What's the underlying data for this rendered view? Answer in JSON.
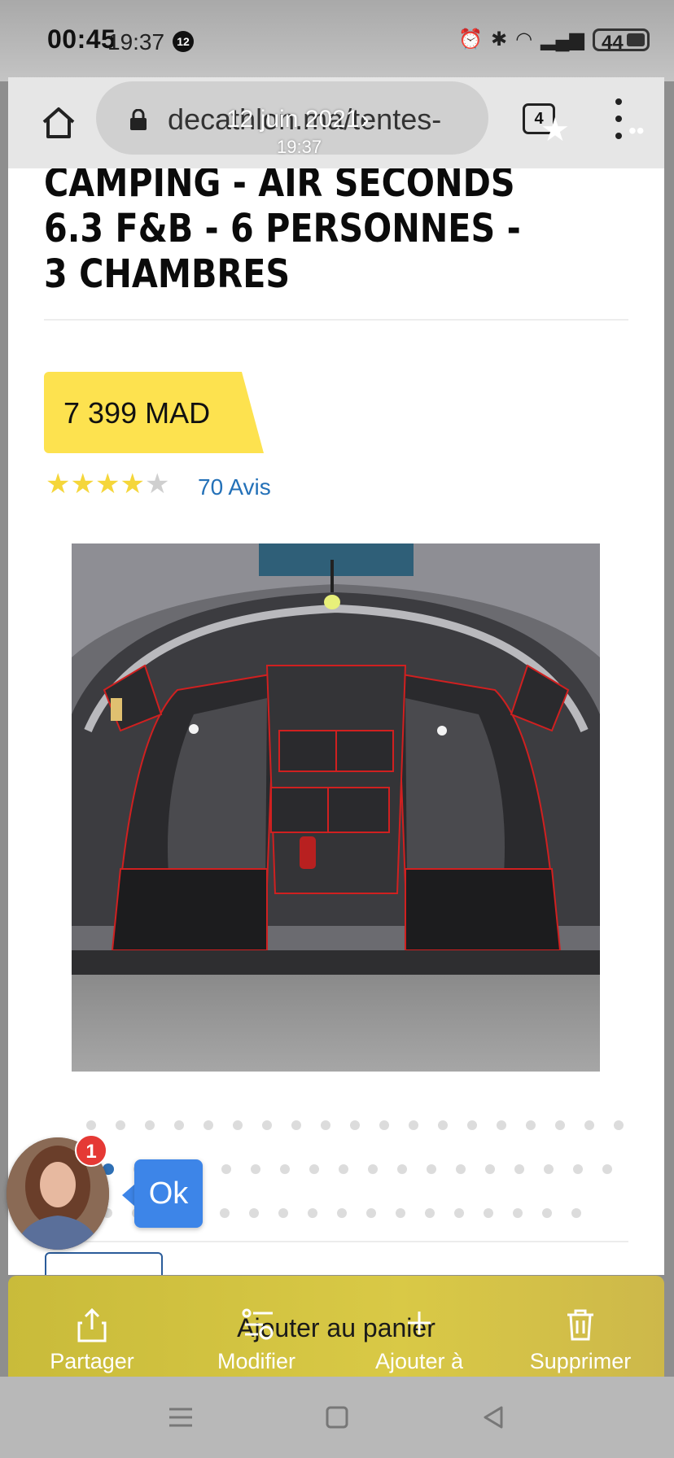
{
  "status_bar": {
    "time": "00:45",
    "time_overlay": "19:37",
    "notification_count": "12",
    "battery": "44"
  },
  "browser": {
    "url": "decathlon.ma/tentes-",
    "date_overlay": "12 juin 2021",
    "time_overlay": "19:37",
    "tab_count": "4"
  },
  "product": {
    "title": "CAMPING - AIR SECONDS 6.3 F&B - 6 PERSONNES - 3 CHAMBRES",
    "price": "7 399 MAD",
    "rating": 4,
    "rating_max": 5,
    "reviews": "70 Avis",
    "image_alt": "tent-interior-photo"
  },
  "carousel": {
    "rows": [
      19,
      18,
      17
    ],
    "active_row": 1,
    "active_index": 0
  },
  "chat_head": {
    "badge": "1",
    "bubble": "Ok"
  },
  "action_bar": {
    "add_to_cart": "Ajouter au panier",
    "share": "Partager",
    "edit": "Modifier",
    "add_to": "Ajouter à",
    "delete": "Supprimer"
  },
  "colors": {
    "accent_yellow": "#fde24f",
    "link_blue": "#2471b8",
    "star_yellow": "#f5d63a",
    "active_dot": "#2e6fb4"
  }
}
